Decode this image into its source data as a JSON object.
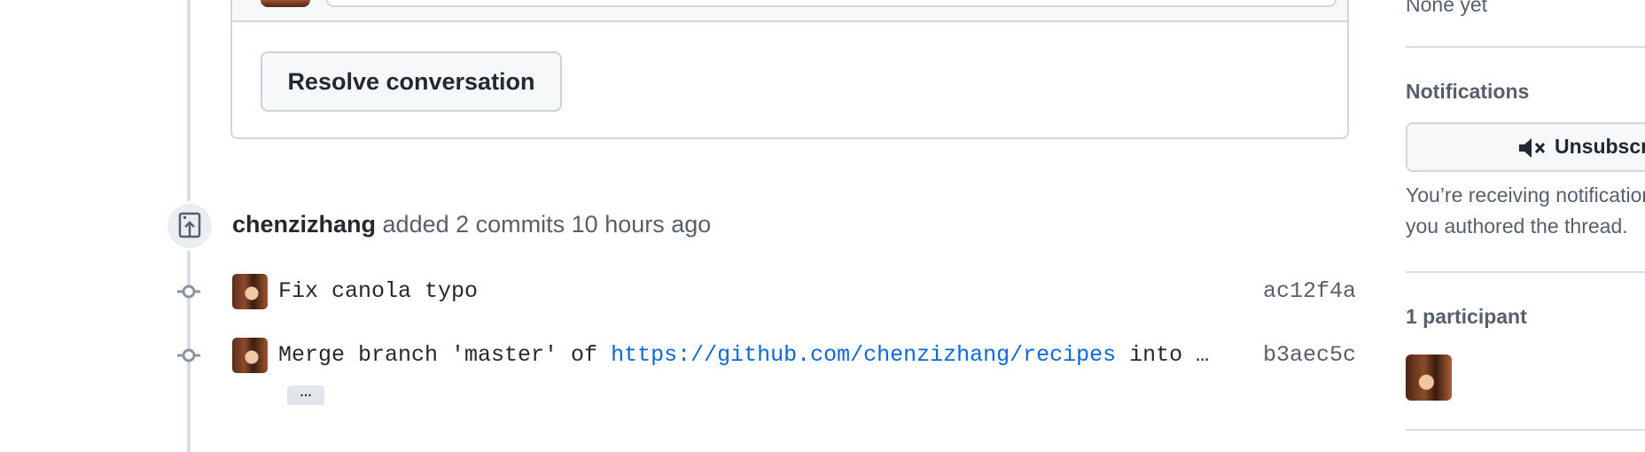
{
  "sidebar": {
    "reviewers_value": "None yet",
    "notifications": {
      "heading": "Notifications",
      "button_label": "Unsubscribe",
      "button_icon": "mute-icon",
      "description_line1": "You’re receiving notifications because",
      "description_line2": "you authored the thread."
    },
    "participants": {
      "heading": "1 participant"
    }
  },
  "review": {
    "resolve_button_label": "Resolve conversation"
  },
  "commits_event": {
    "author": "chenzizhang",
    "action": "added 2 commits",
    "time": "10 hours ago",
    "icon": "repo-push-icon",
    "commits": [
      {
        "message": "Fix canola typo",
        "sha": "ac12f4a"
      },
      {
        "message_prefix": "Merge branch 'master' of ",
        "message_link": "https://github.com/chenzizhang/recipes",
        "message_suffix": " into …",
        "sha": "b3aec5c",
        "expand_label": "…"
      }
    ]
  }
}
